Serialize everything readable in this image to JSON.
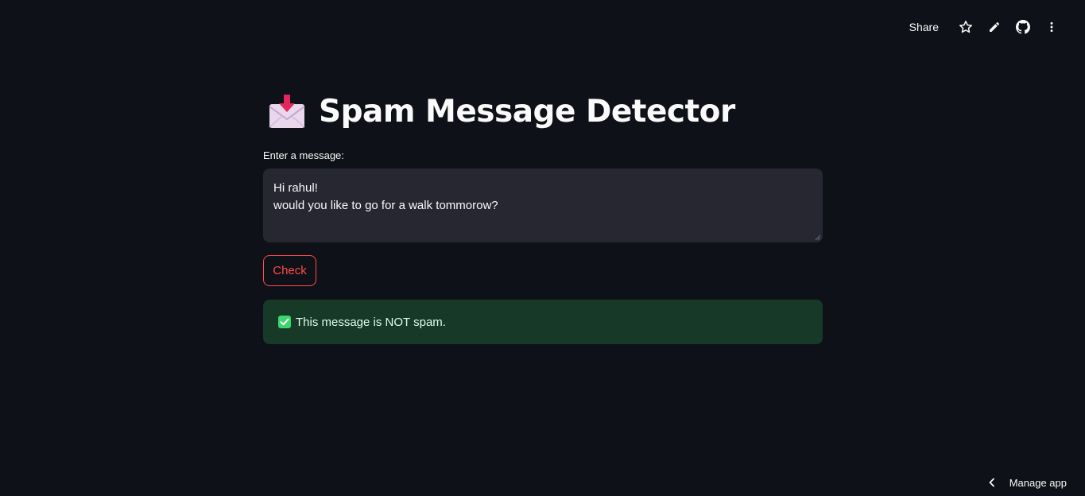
{
  "toolbar": {
    "share_label": "Share",
    "icons": [
      "star-icon",
      "pencil-icon",
      "github-icon",
      "more-vertical-icon"
    ]
  },
  "main": {
    "title_icon": "incoming-envelope-icon",
    "title": "Spam Message Detector",
    "input_label": "Enter a message:",
    "input_value": "Hi rahul!\nwould you like to go for a walk tommorow?",
    "check_button_label": "Check",
    "result": {
      "icon": "check-mark-button-icon",
      "text": "This message is NOT spam."
    }
  },
  "footer": {
    "manage_icon": "chevron-left-icon",
    "manage_label": "Manage app"
  },
  "colors": {
    "background": "#0e1117",
    "input_background": "#262730",
    "accent": "#ff4b4b",
    "success_background": "#173928",
    "success_icon": "#3dd56d"
  }
}
